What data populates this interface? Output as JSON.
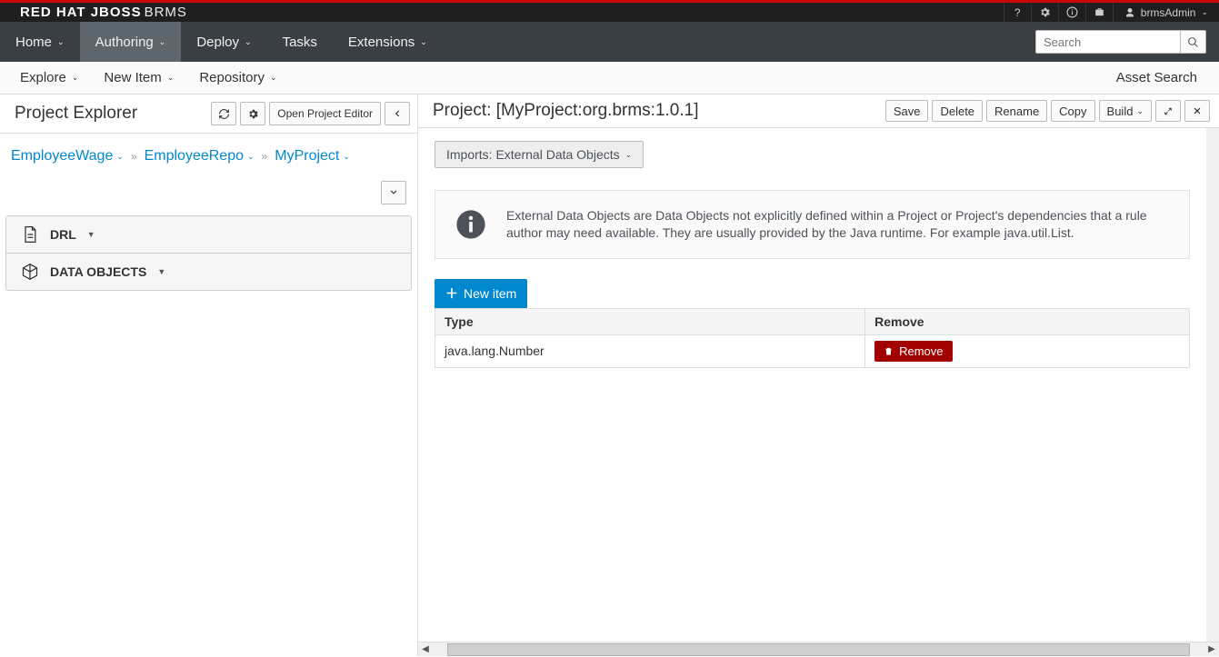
{
  "brand_primary": "RED HAT JBOSS",
  "brand_secondary": "BRMS",
  "user_name": "brmsAdmin",
  "mainnav": {
    "items": [
      {
        "label": "Home"
      },
      {
        "label": "Authoring",
        "active": true
      },
      {
        "label": "Deploy"
      },
      {
        "label": "Tasks"
      },
      {
        "label": "Extensions"
      }
    ],
    "search_placeholder": "Search"
  },
  "subnav": {
    "items": [
      {
        "label": "Explore"
      },
      {
        "label": "New Item"
      },
      {
        "label": "Repository"
      }
    ],
    "asset_search": "Asset Search"
  },
  "project_explorer": {
    "title": "Project Explorer",
    "open_editor_btn": "Open Project Editor",
    "breadcrumbs": [
      "EmployeeWage",
      "EmployeeRepo",
      "MyProject"
    ],
    "folders": [
      {
        "label": "DRL"
      },
      {
        "label": "DATA OBJECTS"
      }
    ]
  },
  "editor": {
    "title": "Project: [MyProject:org.brms:1.0.1]",
    "actions": {
      "save": "Save",
      "delete": "Delete",
      "rename": "Rename",
      "copy": "Copy",
      "build": "Build"
    },
    "imports_label": "Imports: External Data Objects",
    "info_text": "External Data Objects are Data Objects not explicitly defined within a Project or Project's dependencies that a rule author may need available. They are usually provided by the Java runtime. For example java.util.List.",
    "new_item_label": "New item",
    "table": {
      "headers": {
        "type": "Type",
        "remove": "Remove"
      },
      "rows": [
        {
          "type": "java.lang.Number",
          "remove_label": "Remove"
        }
      ]
    }
  }
}
